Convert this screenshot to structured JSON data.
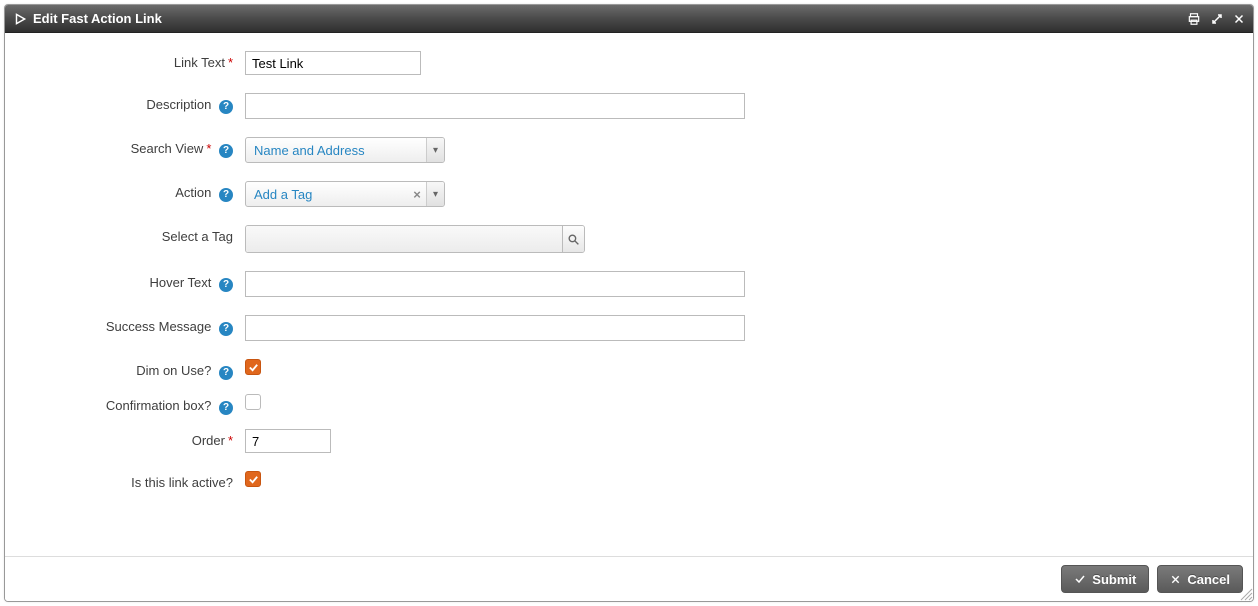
{
  "titlebar": {
    "title": "Edit Fast Action Link"
  },
  "form": {
    "link_text": {
      "label": "Link Text",
      "value": "Test Link"
    },
    "description": {
      "label": "Description",
      "value": ""
    },
    "search_view": {
      "label": "Search View",
      "value": "Name and Address"
    },
    "action": {
      "label": "Action",
      "value": "Add a Tag"
    },
    "select_tag": {
      "label": "Select a Tag",
      "value": ""
    },
    "hover_text": {
      "label": "Hover Text",
      "value": ""
    },
    "success_message": {
      "label": "Success Message",
      "value": ""
    },
    "dim_on_use": {
      "label": "Dim on Use?",
      "checked": true
    },
    "confirmation_box": {
      "label": "Confirmation box?",
      "checked": false
    },
    "order": {
      "label": "Order",
      "value": "7"
    },
    "is_active": {
      "label": "Is this link active?",
      "checked": true
    }
  },
  "buttons": {
    "submit": "Submit",
    "cancel": "Cancel"
  }
}
